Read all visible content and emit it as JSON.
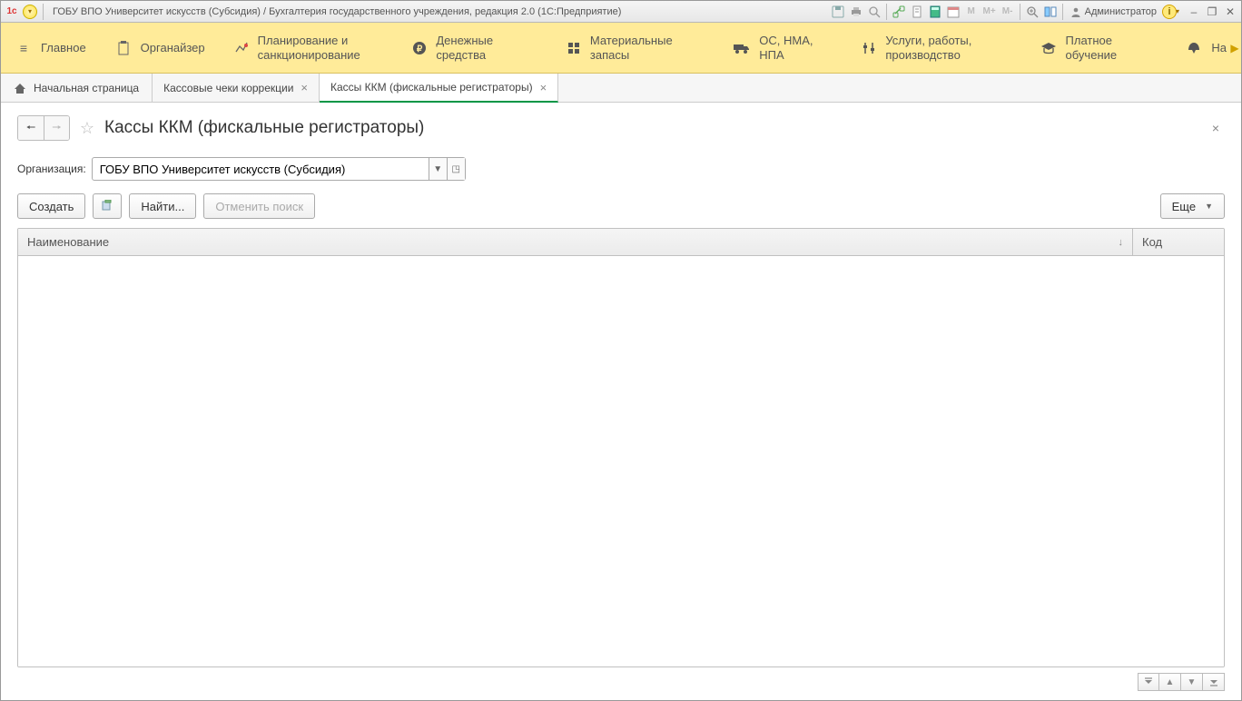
{
  "title_bar": {
    "app_logo": "1c",
    "title": "ГОБУ ВПО Университет искусств (Субсидия) / Бухгалтерия государственного учреждения, редакция 2.0  (1С:Предприятие)",
    "user_label": "Администратор",
    "icon_m": "M",
    "icon_mplus": "M+",
    "icon_mminus": "M-"
  },
  "main_nav": {
    "items": [
      {
        "label": "Главное",
        "icon": "menu"
      },
      {
        "label": "Органайзер",
        "icon": "clipboard"
      },
      {
        "label": "Планирование и санкционирование",
        "icon": "plan"
      },
      {
        "label": "Денежные средства",
        "icon": "ruble"
      },
      {
        "label": "Материальные запасы",
        "icon": "grid"
      },
      {
        "label": "ОС, НМА, НПА",
        "icon": "truck"
      },
      {
        "label": "Услуги, работы, производство",
        "icon": "tools"
      },
      {
        "label": "Платное обучение",
        "icon": "education"
      },
      {
        "label": "На",
        "icon": "eagle"
      }
    ]
  },
  "tabs": {
    "start": "Начальная страница",
    "items": [
      {
        "label": "Кассовые чеки коррекции",
        "active": false
      },
      {
        "label": "Кассы ККМ (фискальные регистраторы)",
        "active": true
      }
    ]
  },
  "page": {
    "title": "Кассы ККМ (фискальные регистраторы)",
    "org_label": "Организация:",
    "org_value": "ГОБУ ВПО Университет искусств (Субсидия)",
    "btn_create": "Создать",
    "btn_find": "Найти...",
    "btn_cancel_search": "Отменить поиск",
    "btn_more": "Еще",
    "columns": {
      "name": "Наименование",
      "code": "Код"
    }
  }
}
